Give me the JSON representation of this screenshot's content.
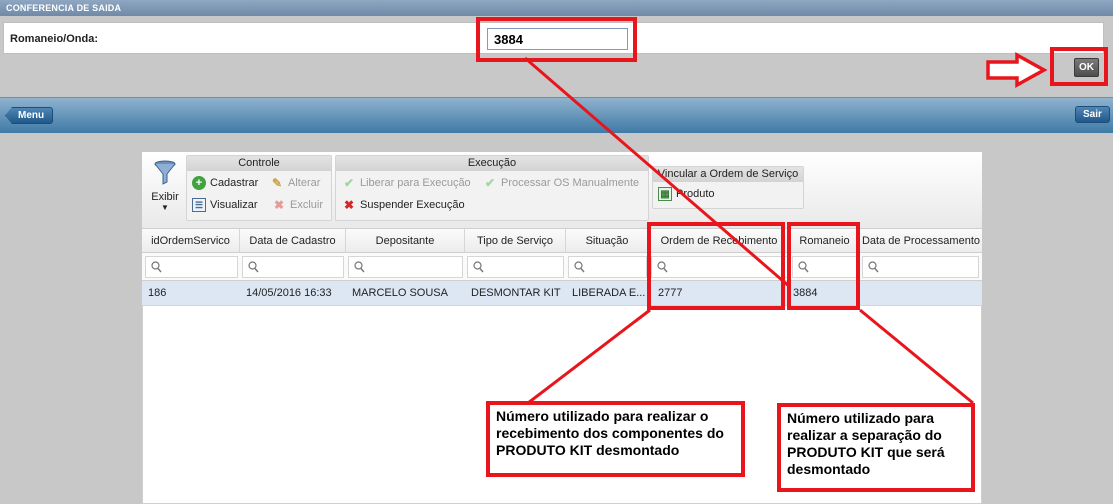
{
  "header": {
    "title": "CONFERENCIA DE SAIDA"
  },
  "form": {
    "label": "Romaneio/Onda:",
    "value": "3884"
  },
  "buttons": {
    "ok": "OK",
    "menu": "Menu",
    "sair": "Sair"
  },
  "toolbar": {
    "exibir": "Exibir",
    "controle": {
      "title": "Controle",
      "cadastrar": "Cadastrar",
      "alterar": "Alterar",
      "visualizar": "Visualizar",
      "excluir": "Excluir"
    },
    "execucao": {
      "title": "Execução",
      "liberar": "Liberar para Execução",
      "processar": "Processar OS Manualmente",
      "suspender": "Suspender Execução"
    },
    "vincular": {
      "title": "Vincular a Ordem de Serviço",
      "produto": "Produto"
    }
  },
  "grid": {
    "columns": [
      "idOrdemServico",
      "Data de Cadastro",
      "Depositante",
      "Tipo de Serviço",
      "Situação",
      "Ordem de Recebimento",
      "Romaneio",
      "Data de Processamento"
    ],
    "rows": [
      {
        "id": "186",
        "data_cadastro": "14/05/2016 16:33",
        "depositante": "MARCELO SOUSA",
        "tipo": "DESMONTAR KIT",
        "situacao": "LIBERADA E...",
        "ordem_recebimento": "2777",
        "romaneio": "3884",
        "data_processamento": ""
      }
    ]
  },
  "annotations": {
    "callout_left": [
      "Número utilizado para realizar o",
      "recebimento dos componentes do",
      "PRODUTO KIT desmontado"
    ],
    "callout_right": [
      "Número utilizado para",
      "realizar a separação do",
      "PRODUTO KIT que será",
      "desmontado"
    ]
  },
  "colors": {
    "annotation": "#e8161c",
    "nav_bar": "#3f7aa6",
    "row_selected": "#dde7f4"
  }
}
